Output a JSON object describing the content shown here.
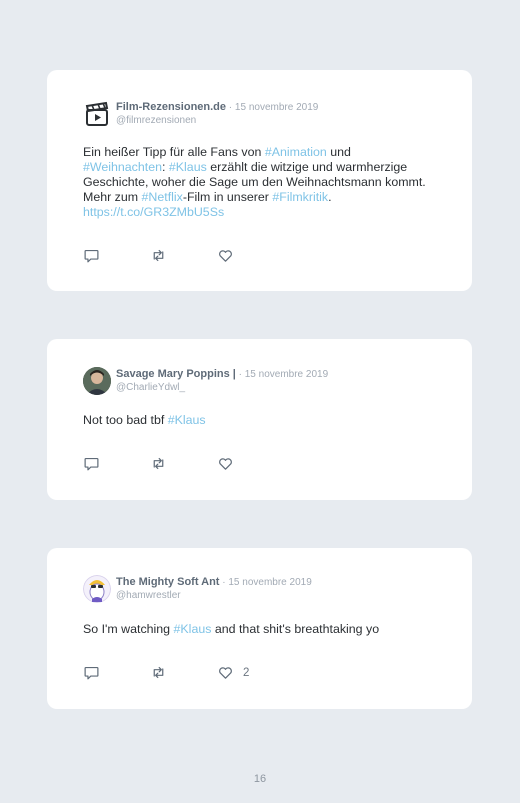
{
  "tweets": [
    {
      "name": "Film-Rezensionen.de",
      "date": " · 15 novembre 2019",
      "handle": "@filmrezensionen",
      "avatar_icon": "clapperboard-icon",
      "body": [
        {
          "t": "Ein heißer Tipp für alle Fans von "
        },
        {
          "t": "#Animation",
          "tag": true
        },
        {
          "t": " und "
        },
        {
          "t": "#Weihnachten",
          "tag": true
        },
        {
          "t": ": "
        },
        {
          "t": "#Klaus",
          "tag": true
        },
        {
          "t": " erzählt die witzige und warmherzige Geschichte, woher die Sage um den Weihnachtsmann kommt. Mehr zum "
        },
        {
          "t": "#Netflix",
          "tag": true
        },
        {
          "t": "-Film in unserer "
        },
        {
          "t": "#Filmkritik",
          "tag": true
        },
        {
          "t": ". "
        },
        {
          "t": "https://t.co/GR3ZMbU5Ss",
          "tag": true
        }
      ],
      "likes": ""
    },
    {
      "name": "Savage Mary Poppins |",
      "date": " · 15 novembre 2019",
      "handle": "@CharlieYdwl_",
      "avatar_icon": "user-photo-avatar",
      "body": [
        {
          "t": "Not too bad tbf "
        },
        {
          "t": "#Klaus",
          "tag": true
        }
      ],
      "likes": ""
    },
    {
      "name": "The Mighty Soft Ant",
      "date": " · 15 novembre 2019",
      "handle": "@hamwrestler",
      "avatar_icon": "cartoon-avatar",
      "body": [
        {
          "t": "So I'm watching "
        },
        {
          "t": "#Klaus",
          "tag": true
        },
        {
          "t": " and that shit's breathtaking yo"
        }
      ],
      "likes": "2"
    }
  ],
  "page_number": "16",
  "colors": {
    "background": "#e7ebf0",
    "card": "#ffffff",
    "hashtag": "#7fc3e6",
    "text": "#2b2f33"
  }
}
